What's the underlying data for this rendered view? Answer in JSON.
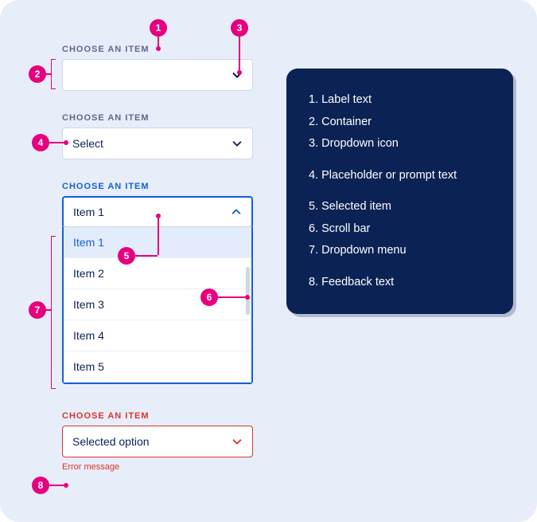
{
  "dropdowns": {
    "empty": {
      "label": "CHOOSE AN ITEM",
      "value": ""
    },
    "placeholder": {
      "label": "CHOOSE AN ITEM",
      "value": "Select"
    },
    "open": {
      "label": "CHOOSE AN ITEM",
      "value": "Item 1",
      "menu": [
        "Item 1",
        "Item 2",
        "Item 3",
        "Item 4",
        "Item 5"
      ]
    },
    "error": {
      "label": "CHOOSE AN ITEM",
      "value": "Selected option",
      "feedback": "Error message"
    }
  },
  "legend": {
    "i1": "1. Label text",
    "i2": "2. Container",
    "i3": "3. Dropdown icon",
    "i4": "4. Placeholder or prompt text",
    "i5": "5. Selected item",
    "i6": "6. Scroll bar",
    "i7": "7. Dropdown menu",
    "i8": "8. Feedback text"
  },
  "annotations": {
    "b1": "1",
    "b2": "2",
    "b3": "3",
    "b4": "4",
    "b5": "5",
    "b6": "6",
    "b7": "7",
    "b8": "8"
  },
  "colors": {
    "bg": "#e8edfa",
    "navy": "#0b2254",
    "blue": "#1560d6",
    "error": "#d9362b",
    "magenta": "#e6007e"
  }
}
